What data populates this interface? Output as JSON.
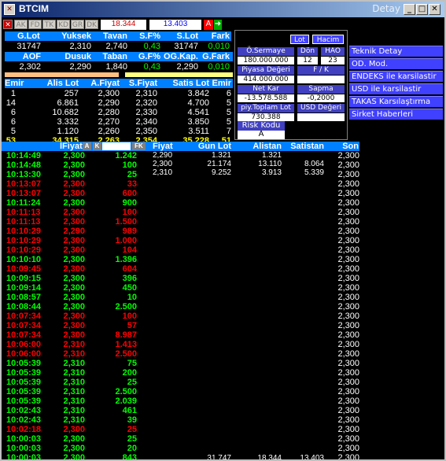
{
  "window": {
    "title": "BTCIM",
    "title_right": "Detay"
  },
  "toolbar": {
    "buttons": [
      "AK",
      "FD",
      "TK",
      "KD",
      "GR",
      "DK"
    ],
    "box1": "18.344",
    "box2": "13.403",
    "flag": "A"
  },
  "summary": {
    "h1": [
      "G.Lot",
      "Yuksek",
      "Tavan",
      "S.F%",
      "S.Lot",
      "Fark"
    ],
    "v1": [
      "31747",
      "2,310",
      "2,740",
      "0,43",
      "31747",
      "0,010"
    ],
    "h2": [
      "AOF",
      "Dusuk",
      "Taban",
      "G.F%",
      "OG.Kap.",
      "G.Fark"
    ],
    "v2": [
      "2,302",
      "2,290",
      "1,840",
      "0,43",
      "2,290",
      "0,010"
    ]
  },
  "depth": {
    "headers": [
      "Emir",
      "Alis Lot",
      "A.Fiyat",
      "S.Fiyat",
      "Satis Lot",
      "Emir"
    ],
    "rows": [
      [
        "1",
        "257",
        "2,300",
        "2,310",
        "3.842",
        "6"
      ],
      [
        "14",
        "6.861",
        "2,290",
        "2,320",
        "4.700",
        "5"
      ],
      [
        "6",
        "10.682",
        "2,280",
        "2,330",
        "4.541",
        "5"
      ],
      [
        "6",
        "3.332",
        "2,270",
        "2,340",
        "3.850",
        "5"
      ],
      [
        "5",
        "1.120",
        "2,260",
        "2,350",
        "3.511",
        "7"
      ]
    ],
    "totals": [
      "53",
      "34.315",
      "2,263",
      "2,354",
      "35.228",
      "51"
    ]
  },
  "fund": {
    "btn_lot": "Lot",
    "btn_hacim": "Hacim",
    "osermaye_lbl": "Ö.Sermaye",
    "osermaye_val": "180.000.000",
    "don_lbl": "Dön",
    "don_val": "12",
    "hao_lbl": "HAO",
    "hao_val": "23",
    "piyasa_lbl": "Piyasa Değeri",
    "piyasa_val": "414.000.000",
    "fk_lbl": "F / K",
    "fk_val": "",
    "netkar_lbl": "Net Kar",
    "netkar_val": "-13.578.588",
    "sapma_lbl": "Sapma",
    "sapma_val": "-0,2000",
    "piytop_lbl": "piy.Toplam Lot",
    "piytop_val": "730.388",
    "usd_lbl": "USD Değeri",
    "usd_val": "",
    "risk_lbl": "Risk Kodu",
    "risk_val": "A"
  },
  "menu": [
    "Teknik Detay",
    "OD. Mod.",
    "ENDEKS ile karsilastir",
    "USD ile karsilastir",
    "TAKAS Karsılaştırma",
    "Sirket Haberleri"
  ],
  "tradehdr": {
    "fiyat": "lFiyat",
    "a": "A",
    "k": "K",
    "fk": "FK"
  },
  "trades": [
    [
      "10:14:49",
      "2,300",
      "1.242",
      "g"
    ],
    [
      "10:14:48",
      "2,300",
      "100",
      "g"
    ],
    [
      "10:13:30",
      "2,300",
      "25",
      "g"
    ],
    [
      "10:13:07",
      "2,300",
      "33",
      "r"
    ],
    [
      "10:13:07",
      "2,300",
      "600",
      "r"
    ],
    [
      "10:11:24",
      "2,300",
      "900",
      "g"
    ],
    [
      "10:11:13",
      "2,300",
      "100",
      "r"
    ],
    [
      "10:11:13",
      "2,300",
      "1.500",
      "r"
    ],
    [
      "10:10:29",
      "2,290",
      "989",
      "r"
    ],
    [
      "10:10:29",
      "2,300",
      "1.000",
      "r"
    ],
    [
      "10:10:29",
      "2,300",
      "104",
      "r"
    ],
    [
      "10:10:10",
      "2,300",
      "1.396",
      "g"
    ],
    [
      "10:09:45",
      "2,300",
      "604",
      "r"
    ],
    [
      "10:09:15",
      "2,300",
      "396",
      "g"
    ],
    [
      "10:09:14",
      "2,300",
      "450",
      "g"
    ],
    [
      "10:08:57",
      "2,300",
      "10",
      "g"
    ],
    [
      "10:08:44",
      "2,300",
      "2.500",
      "g"
    ],
    [
      "10:07:34",
      "2,300",
      "100",
      "r"
    ],
    [
      "10:07:34",
      "2,300",
      "57",
      "r"
    ],
    [
      "10:07:34",
      "2,300",
      "8.987",
      "r"
    ],
    [
      "10:06:00",
      "2,310",
      "1.413",
      "r"
    ],
    [
      "10:06:00",
      "2,310",
      "2.500",
      "r"
    ],
    [
      "10:05:39",
      "2,310",
      "75",
      "g"
    ],
    [
      "10:05:39",
      "2,310",
      "200",
      "g"
    ],
    [
      "10:05:39",
      "2,310",
      "25",
      "g"
    ],
    [
      "10:05:39",
      "2,310",
      "2.500",
      "g"
    ],
    [
      "10:05:39",
      "2,310",
      "2.039",
      "g"
    ],
    [
      "10:02:43",
      "2,310",
      "461",
      "g"
    ],
    [
      "10:02:43",
      "2,310",
      "39",
      "g"
    ],
    [
      "10:02:18",
      "2,300",
      "25",
      "r"
    ],
    [
      "10:00:03",
      "2,300",
      "25",
      "g"
    ],
    [
      "10:00:03",
      "2,300",
      "20",
      "g"
    ],
    [
      "10:00:03",
      "2,300",
      "843",
      "g"
    ]
  ],
  "dist": {
    "headers": [
      "Fiyat",
      "Gun Lot",
      "Alistan",
      "Satistan",
      "Son"
    ],
    "rows": [
      [
        "2,290",
        "1.321",
        "1.321",
        ""
      ],
      [
        "2,300",
        "21.174",
        "13.110",
        "8.064"
      ],
      [
        "2,310",
        "9.252",
        "3.913",
        "5.339"
      ]
    ],
    "footer": [
      "31.747",
      "18.344",
      "13.403"
    ]
  },
  "son": [
    "2,300",
    "2,300",
    "2,300",
    "2,300",
    "2,300",
    "2,300",
    "2,300",
    "2,300",
    "2,300",
    "2,300",
    "2,300",
    "2,300",
    "2,300",
    "2,300",
    "2,300",
    "2,300",
    "2,300",
    "2,300",
    "2,300",
    "2,300",
    "2,300",
    "2,300",
    "2,300",
    "2,300",
    "2,300",
    "2,300",
    "2,300",
    "2,300",
    "2,300",
    "2,300",
    "2,300",
    "2,300",
    "2,300"
  ]
}
